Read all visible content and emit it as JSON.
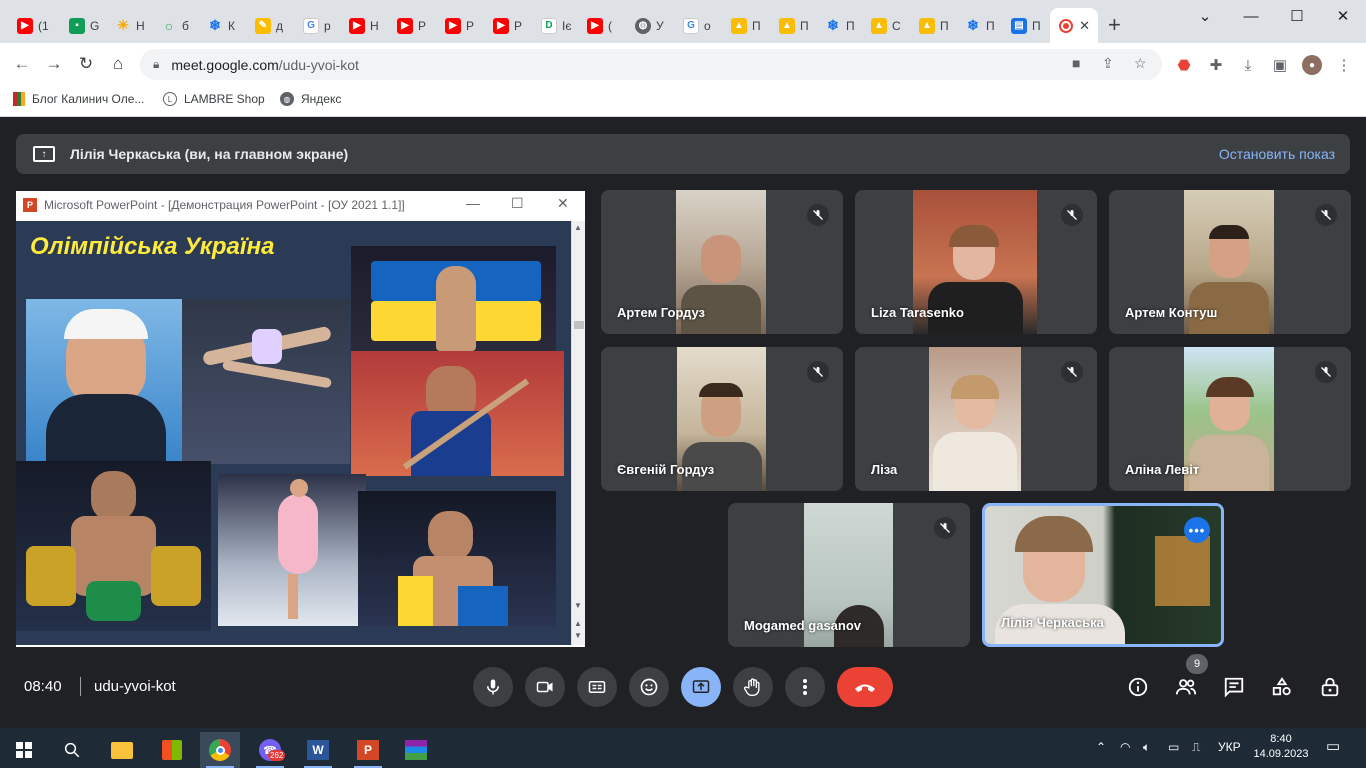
{
  "browser": {
    "tabs": [
      {
        "label": "(1",
        "icon": "youtube-icon"
      },
      {
        "label": "G",
        "icon": "classroom-icon"
      },
      {
        "label": "Н",
        "icon": "sun-icon"
      },
      {
        "label": "б",
        "icon": "circle-icon"
      },
      {
        "label": "К",
        "icon": "snowflake-icon"
      },
      {
        "label": "д",
        "icon": "drawing-icon"
      },
      {
        "label": "р",
        "icon": "google-icon"
      },
      {
        "label": "Н",
        "icon": "youtube-icon"
      },
      {
        "label": "Р",
        "icon": "youtube-icon"
      },
      {
        "label": "Р",
        "icon": "youtube-icon"
      },
      {
        "label": "Р",
        "icon": "youtube-icon"
      },
      {
        "label": "Іє",
        "icon": "d-icon"
      },
      {
        "label": "(",
        "icon": "youtube-icon"
      },
      {
        "label": "У",
        "icon": "globe-icon"
      },
      {
        "label": "о",
        "icon": "google-icon"
      },
      {
        "label": "П",
        "icon": "bell-icon"
      },
      {
        "label": "П",
        "icon": "bell-icon"
      },
      {
        "label": "П",
        "icon": "snowflake-icon"
      },
      {
        "label": "С",
        "icon": "bell-icon"
      },
      {
        "label": "П",
        "icon": "bell-icon"
      },
      {
        "label": "П",
        "icon": "snowflake-icon"
      },
      {
        "label": "П",
        "icon": "book-icon"
      }
    ],
    "active_tab_close": "✕",
    "new_tab": "+",
    "url_host": "meet.google.com",
    "url_path": "/udu-yvoi-kot",
    "bookmarks": [
      {
        "label": "Блог Калинич Оле...",
        "icon": "bookmark-icon"
      },
      {
        "label": "LAMBRE Shop",
        "icon": "lambre-icon"
      },
      {
        "label": "Яндекс",
        "icon": "globe-icon"
      }
    ]
  },
  "meet": {
    "banner_title": "Лілія Черкаська (ви, на главном экране)",
    "banner_stop": "Остановить показ",
    "presentation": {
      "window_title": "Microsoft PowerPoint - [Демонстрация PowerPoint - [ОУ 2021 1.1]]",
      "slide_title": "Олімпійська Україна"
    },
    "participants": [
      {
        "name": "Артем Гордуз"
      },
      {
        "name": "Liza Tarasenko"
      },
      {
        "name": "Артем Контуш"
      },
      {
        "name": "Євгеній Гордуз"
      },
      {
        "name": "Ліза"
      },
      {
        "name": "Аліна Левіт"
      },
      {
        "name": "Mogamed gasanov"
      },
      {
        "name": "Лілія Черкаська"
      }
    ],
    "clock": "08:40",
    "meeting_code": "udu-yvoi-kot",
    "participant_count": "9"
  },
  "taskbar": {
    "lang": "УКР",
    "time": "8:40",
    "date": "14.09.2023",
    "viber_badge": "262"
  },
  "colors": {
    "meet_bg": "#202124",
    "tile_bg": "#3c4043",
    "accent_blue": "#8ab4f8",
    "end_call_red": "#ea4335",
    "slide_title_yellow": "#ffeb3b"
  }
}
